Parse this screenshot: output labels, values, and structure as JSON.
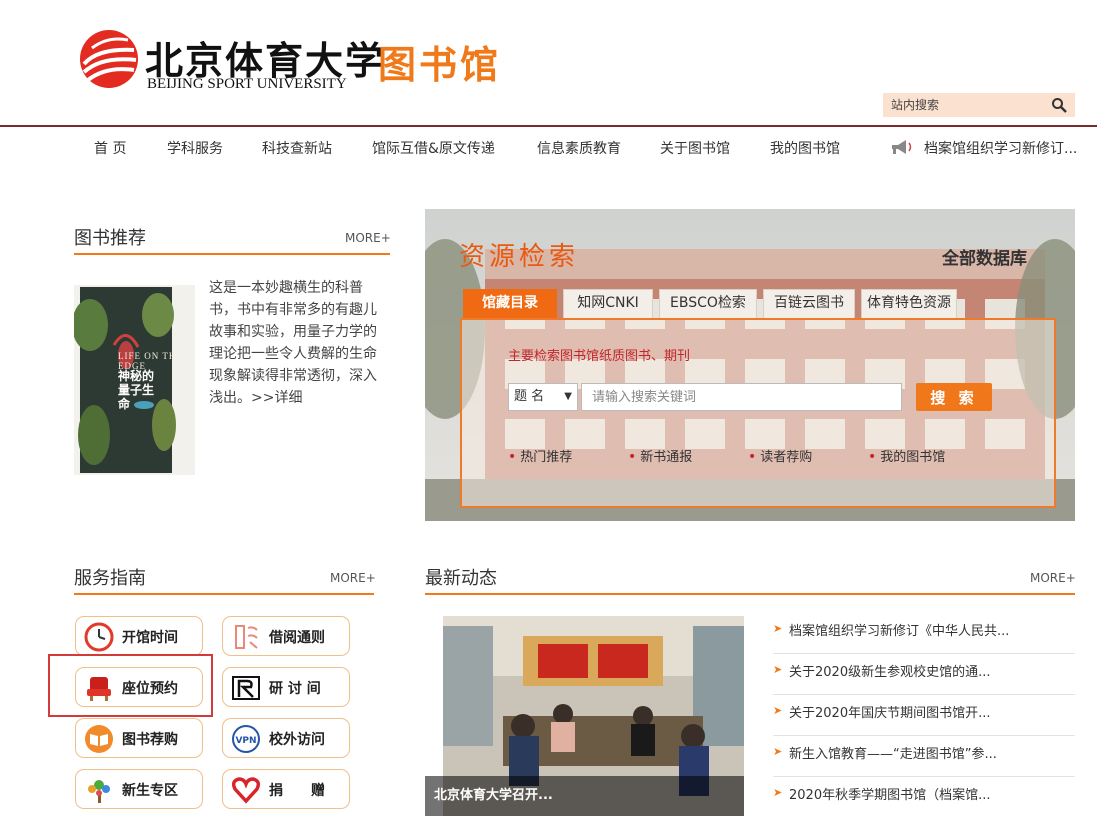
{
  "header": {
    "logo_cn": "北京体育大学",
    "logo_en": "BEIJING SPORT UNIVERSITY",
    "library_title": "图书馆",
    "search_placeholder": "站内搜索"
  },
  "nav": {
    "items": [
      "首 页",
      "学科服务",
      "科技查新站",
      "馆际互借&原文传递",
      "信息素质教育",
      "关于图书馆",
      "我的图书馆"
    ],
    "ticker": "档案馆组织学习新修订..."
  },
  "book_recommend": {
    "title": "图书推荐",
    "more": "MORE+",
    "cover_title": "神秘的量子生命",
    "cover_en": "LIFE ON THE EDGE",
    "description": "这是一本妙趣横生的科普书，书中有非常多的有趣儿故事和实验，用量子力学的理论把一些令人费解的生命现象解读得非常透彻，深入浅出。>>详细"
  },
  "resource_search": {
    "title": "资源检索",
    "all_db": "全部数据库",
    "tabs": [
      "馆藏目录",
      "知网CNKI",
      "EBSCO检索",
      "百链云图书",
      "体育特色资源"
    ],
    "active_tab": 0,
    "hint": "主要检索图书馆纸质图书、期刊",
    "field_selected": "题 名",
    "keyword_placeholder": "请输入搜索关键词",
    "search_button": "搜 索",
    "links": [
      "热门推荐",
      "新书通报",
      "读者荐购",
      "我的图书馆"
    ]
  },
  "service_guide": {
    "title": "服务指南",
    "more": "MORE+",
    "items": [
      {
        "label": "开馆时间",
        "icon": "clock-icon"
      },
      {
        "label": "借阅通则",
        "icon": "book-rules-icon"
      },
      {
        "label": "座位预约",
        "icon": "seat-icon"
      },
      {
        "label": "研 讨 间",
        "icon": "discussion-room-icon"
      },
      {
        "label": "图书荐购",
        "icon": "book-open-icon"
      },
      {
        "label": "校外访问",
        "icon": "vpn-icon"
      },
      {
        "label": "新生专区",
        "icon": "tree-icon"
      },
      {
        "label": "捐　　赠",
        "icon": "heart-icon"
      }
    ]
  },
  "news": {
    "title": "最新动态",
    "more": "MORE+",
    "photo_caption": "北京体育大学召开...",
    "items": [
      "档案馆组织学习新修订《中华人民共...",
      "关于2020级新生参观校史馆的通...",
      "关于2020年国庆节期间图书馆开...",
      "新生入馆教育——“走进图书馆”参...",
      "2020年秋季学期图书馆（档案馆..."
    ]
  },
  "colors": {
    "accent": "#f07a1a",
    "header_line": "#7a2a2a",
    "highlight_box": "#d53a3a"
  }
}
